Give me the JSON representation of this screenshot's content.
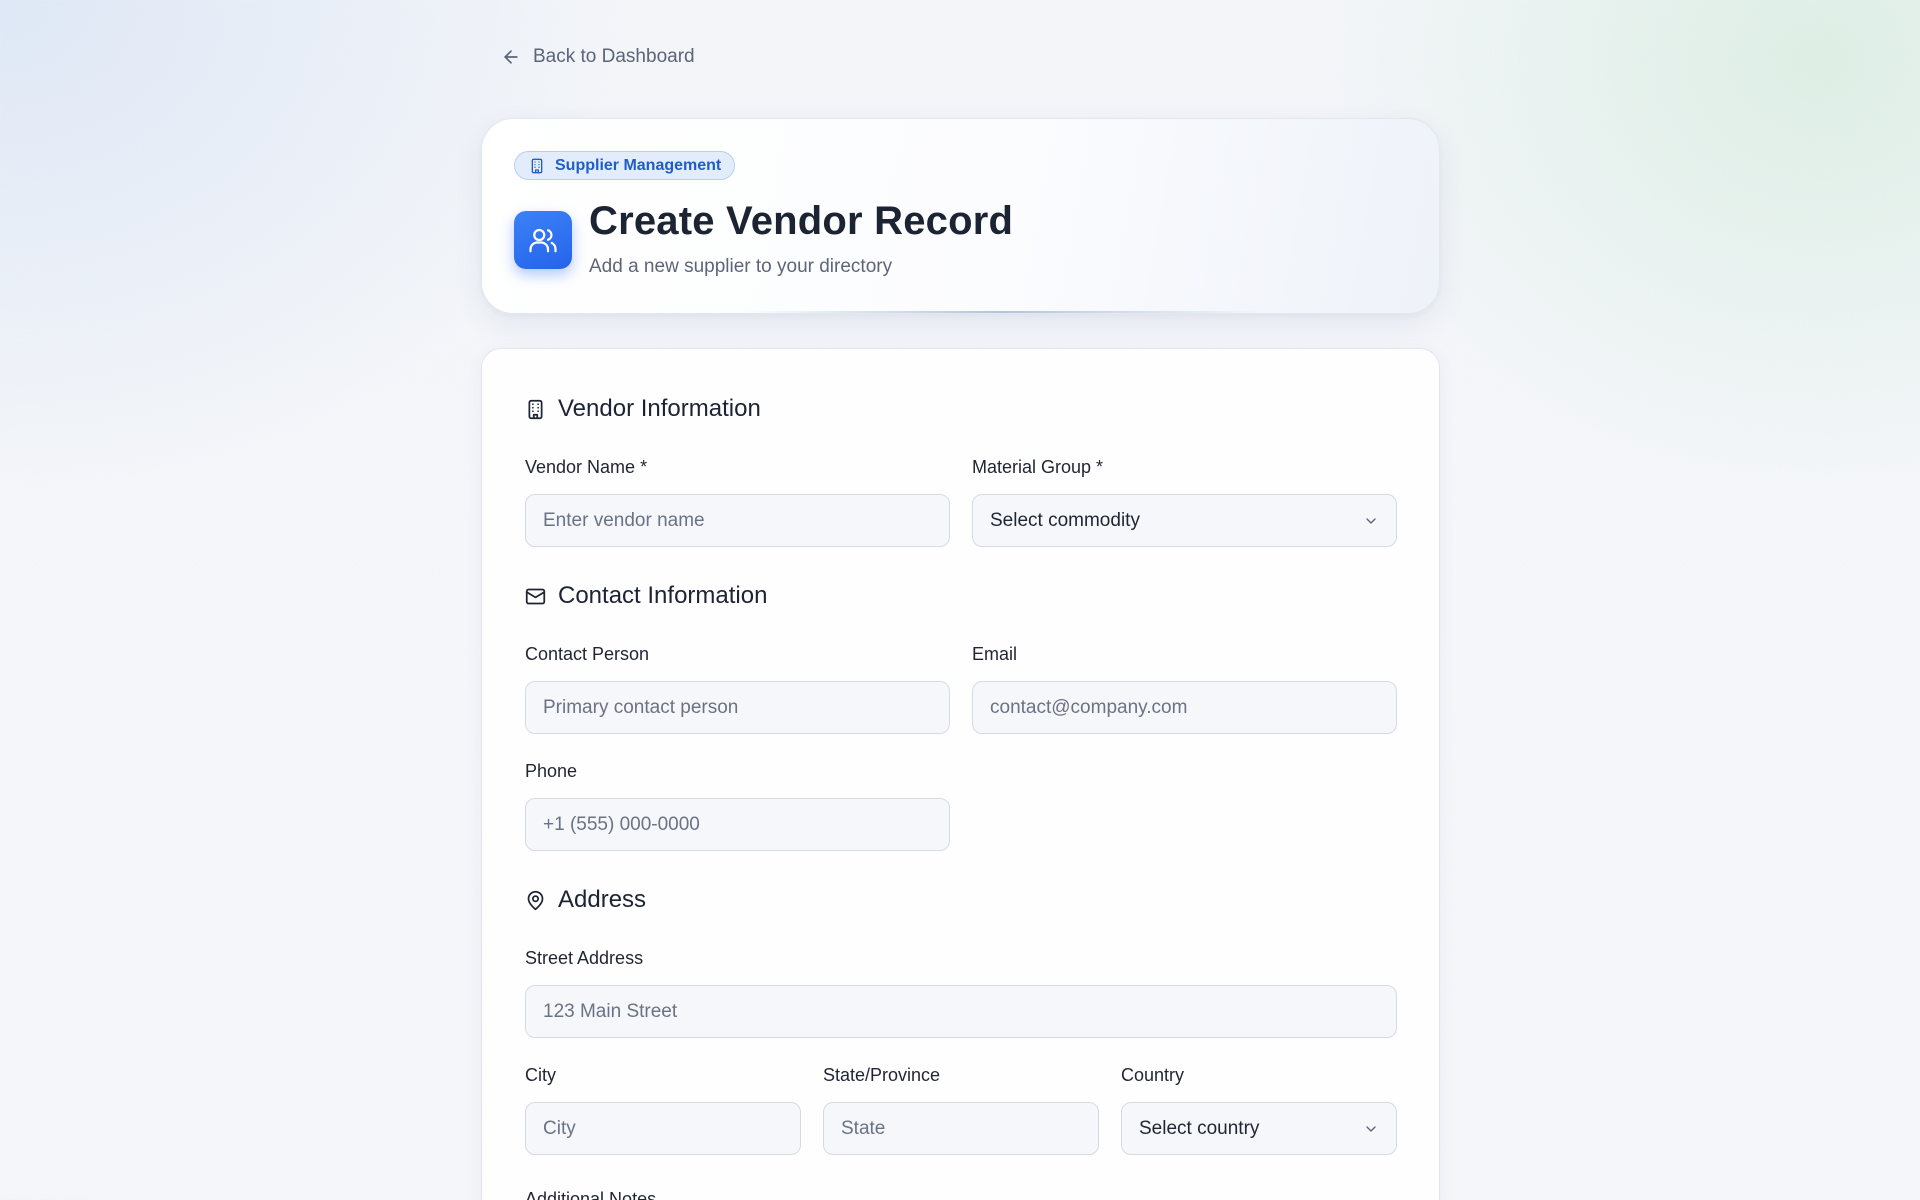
{
  "nav": {
    "back_label": "Back to Dashboard",
    "back_icon": "arrow-left-icon"
  },
  "header": {
    "badge_label": "Supplier Management",
    "badge_icon": "building-icon",
    "app_icon": "users-icon",
    "title": "Create Vendor Record",
    "subtitle": "Add a new supplier to your directory"
  },
  "colors": {
    "accent": "#2563eb",
    "badge_text": "#1f5fc4",
    "badge_bg": "#e3ecfb"
  },
  "sections": {
    "vendor": {
      "title": "Vendor Information",
      "icon": "building-icon",
      "vendor_name": {
        "label": "Vendor Name *",
        "placeholder": "Enter vendor name",
        "value": ""
      },
      "material_group": {
        "label": "Material Group *",
        "selected": "Select commodity"
      }
    },
    "contact": {
      "title": "Contact Information",
      "icon": "mail-icon",
      "contact_person": {
        "label": "Contact Person",
        "placeholder": "Primary contact person",
        "value": ""
      },
      "email": {
        "label": "Email",
        "placeholder": "contact@company.com",
        "value": ""
      },
      "phone": {
        "label": "Phone",
        "placeholder": "+1 (555) 000-0000",
        "value": ""
      }
    },
    "address": {
      "title": "Address",
      "icon": "map-pin-icon",
      "street": {
        "label": "Street Address",
        "placeholder": "123 Main Street",
        "value": ""
      },
      "city": {
        "label": "City",
        "placeholder": "City",
        "value": ""
      },
      "state": {
        "label": "State/Province",
        "placeholder": "State",
        "value": ""
      },
      "country": {
        "label": "Country",
        "selected": "Select country"
      }
    },
    "notes": {
      "title": "Additional Notes"
    }
  }
}
